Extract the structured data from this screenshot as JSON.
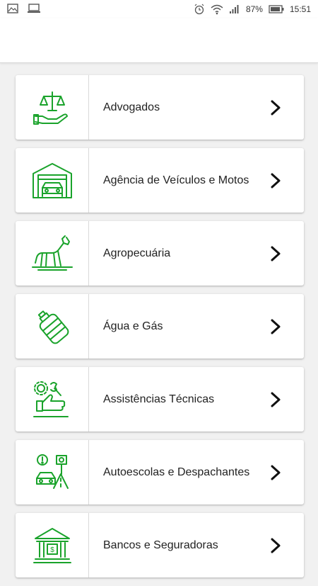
{
  "status_bar": {
    "battery": "87%",
    "time": "15:51"
  },
  "app_bar": {
    "title": "",
    "action": ""
  },
  "colors": {
    "accent": "#1aa32b",
    "text": "#222222"
  },
  "categories": [
    {
      "label": "Advogados",
      "icon": "justice-scale-hand-icon"
    },
    {
      "label": "Agência de Veículos e Motos",
      "icon": "car-garage-icon"
    },
    {
      "label": "Agropecuária",
      "icon": "horse-icon"
    },
    {
      "label": "Água e Gás",
      "icon": "water-gallon-icon"
    },
    {
      "label": "Assistências Técnicas",
      "icon": "tools-thumbs-up-icon"
    },
    {
      "label": "Autoescolas e Despachantes",
      "icon": "driving-school-icon"
    },
    {
      "label": "Bancos e Seguradoras",
      "icon": "bank-icon"
    }
  ]
}
